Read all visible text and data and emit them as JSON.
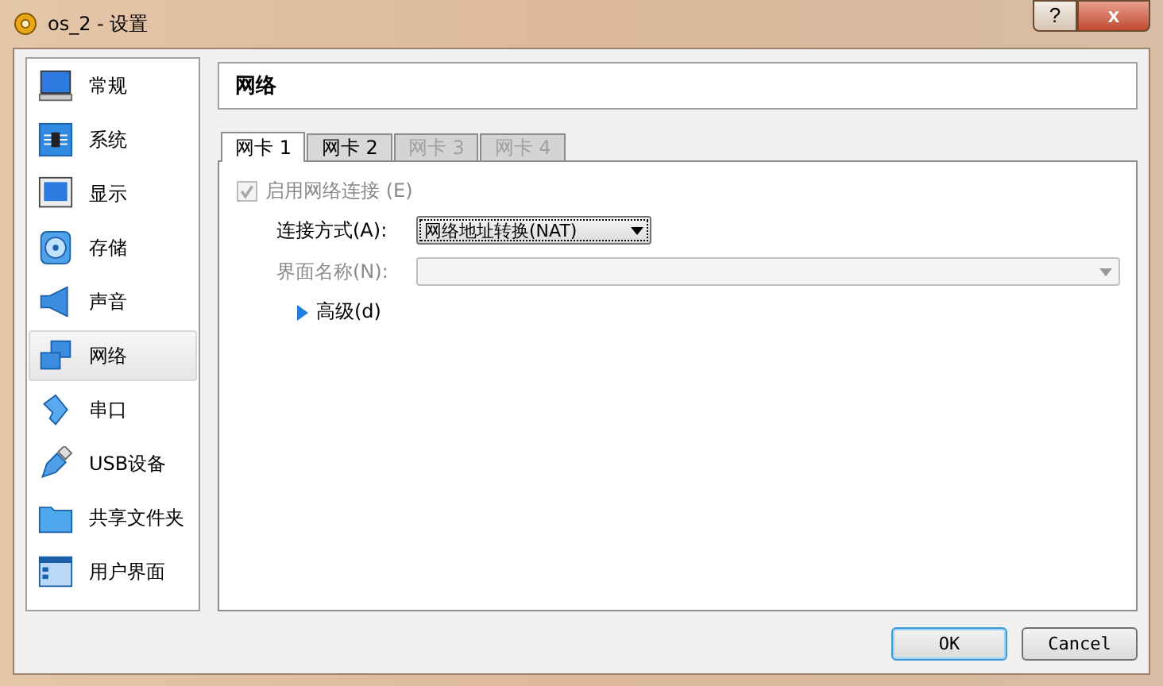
{
  "window": {
    "title": "os_2 - 设置",
    "help_button": "?",
    "close_button": "x"
  },
  "sidebar": {
    "items": [
      {
        "label": "常规",
        "selected": false
      },
      {
        "label": "系统",
        "selected": false
      },
      {
        "label": "显示",
        "selected": false
      },
      {
        "label": "存储",
        "selected": false
      },
      {
        "label": "声音",
        "selected": false
      },
      {
        "label": "网络",
        "selected": true
      },
      {
        "label": "串口",
        "selected": false
      },
      {
        "label": "USB设备",
        "selected": false
      },
      {
        "label": "共享文件夹",
        "selected": false
      },
      {
        "label": "用户界面",
        "selected": false
      }
    ]
  },
  "page_title": "网络",
  "tabs": [
    {
      "label": "网卡 1",
      "selected": true,
      "disabled": false
    },
    {
      "label": "网卡 2",
      "selected": false,
      "disabled": false
    },
    {
      "label": "网卡 3",
      "selected": false,
      "disabled": true
    },
    {
      "label": "网卡 4",
      "selected": false,
      "disabled": true
    }
  ],
  "enable_checkbox": {
    "label": "启用网络连接 (E)",
    "checked": true,
    "disabled": true
  },
  "attached_to": {
    "label": "连接方式(A):",
    "value": "网络地址转换(NAT)",
    "disabled": false
  },
  "interface_name": {
    "label": "界面名称(N):",
    "disabled": true
  },
  "advanced": {
    "label": "高级(d)",
    "expanded": false
  },
  "buttons": [
    {
      "label": "OK",
      "default": true
    },
    {
      "label": "Cancel",
      "default": false
    }
  ]
}
